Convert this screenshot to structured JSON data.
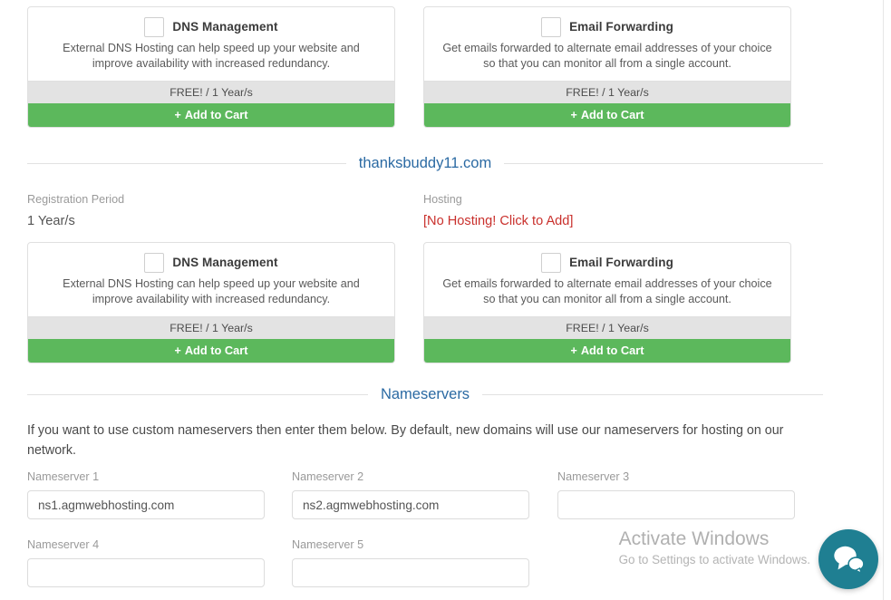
{
  "colors": {
    "green": "#5cb85c",
    "blue": "#2b6aa3",
    "danger": "#c9302c",
    "price_band": "#e3e3e3",
    "chat_teal": "#1f7f92"
  },
  "addon_cards": [
    {
      "title": "DNS Management",
      "description": "External DNS Hosting can help speed up your website and improve availability with increased redundancy.",
      "price": "FREE! / 1 Year/s",
      "button": "Add to Cart",
      "checked": false
    },
    {
      "title": "Email Forwarding",
      "description": "Get emails forwarded to alternate email addresses of your choice so that you can monitor all from a single account.",
      "price": "FREE! / 1 Year/s",
      "button": "Add to Cart",
      "checked": false
    }
  ],
  "domain_section": {
    "domain": "thanksbuddy11.com",
    "registration_period_label": "Registration Period",
    "registration_period_value": "1 Year/s",
    "hosting_label": "Hosting",
    "hosting_value": "[No Hosting! Click to Add]"
  },
  "domain_addon_cards": [
    {
      "title": "DNS Management",
      "description": "External DNS Hosting can help speed up your website and improve availability with increased redundancy.",
      "price": "FREE! / 1 Year/s",
      "button": "Add to Cart",
      "checked": false
    },
    {
      "title": "Email Forwarding",
      "description": "Get emails forwarded to alternate email addresses of your choice so that you can monitor all from a single account.",
      "price": "FREE! / 1 Year/s",
      "button": "Add to Cart",
      "checked": false
    }
  ],
  "nameservers": {
    "heading": "Nameservers",
    "description": "If you want to use custom nameservers then enter them below. By default, new domains will use our nameservers for hosting on our network.",
    "fields": [
      {
        "label": "Nameserver 1",
        "value": "ns1.agmwebhosting.com",
        "placeholder": ""
      },
      {
        "label": "Nameserver 2",
        "value": "ns2.agmwebhosting.com",
        "placeholder": ""
      },
      {
        "label": "Nameserver 3",
        "value": "",
        "placeholder": ""
      },
      {
        "label": "Nameserver 4",
        "value": "",
        "placeholder": ""
      },
      {
        "label": "Nameserver 5",
        "value": "",
        "placeholder": ""
      }
    ]
  },
  "watermark": {
    "line1": "Activate Windows",
    "line2": "Go to Settings to activate Windows."
  },
  "icons": {
    "plus": "+",
    "chat": "chat-bubbles-icon"
  }
}
